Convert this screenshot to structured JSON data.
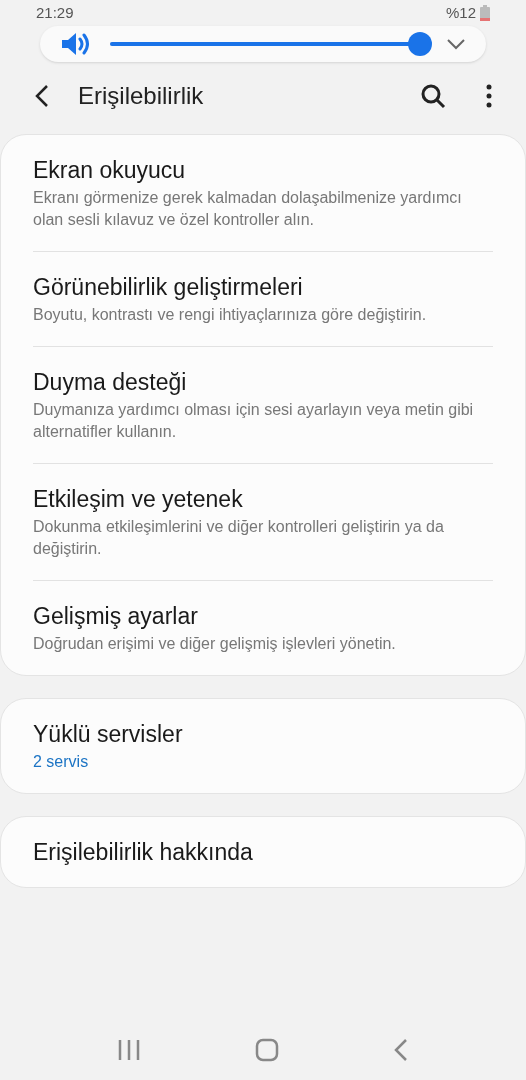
{
  "status_bar": {
    "time": "21:29",
    "battery": "%12"
  },
  "volume": {
    "level": 0.98
  },
  "header": {
    "title": "Erişilebilirlik"
  },
  "groups": [
    {
      "items": [
        {
          "title": "Ekran okuyucu",
          "subtitle": "Ekranı görmenize gerek kalmadan dolaşabilmenize yardımcı olan sesli kılavuz ve özel kontroller alın.",
          "kind": "plain"
        },
        {
          "title": "Görünebilirlik geliştirmeleri",
          "subtitle": "Boyutu, kontrastı ve rengi ihtiyaçlarınıza göre değiştirin.",
          "kind": "plain"
        },
        {
          "title": "Duyma desteği",
          "subtitle": "Duymanıza yardımcı olması için sesi ayarlayın veya metin gibi alternatifler kullanın.",
          "kind": "plain"
        },
        {
          "title": "Etkileşim ve yetenek",
          "subtitle": "Dokunma etkileşimlerini ve diğer kontrolleri geliştirin ya da değiştirin.",
          "kind": "plain"
        },
        {
          "title": "Gelişmiş ayarlar",
          "subtitle": "Doğrudan erişimi ve diğer gelişmiş işlevleri yönetin.",
          "kind": "plain"
        }
      ]
    },
    {
      "items": [
        {
          "title": "Yüklü servisler",
          "subtitle": "2 servis",
          "kind": "accent"
        }
      ]
    },
    {
      "items": [
        {
          "title": "Erişilebilirlik hakkında",
          "kind": "plain"
        }
      ]
    }
  ]
}
